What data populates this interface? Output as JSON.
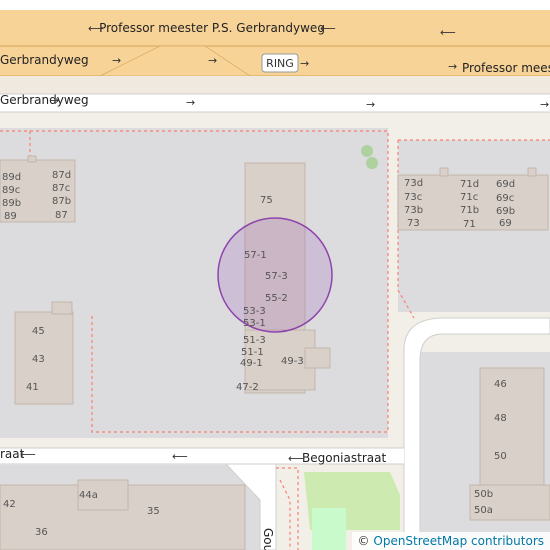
{
  "map": {
    "streets": {
      "top_road": "Professor meester P.S. Gerbrandyweg",
      "mid_left": "Gerbrandyweg",
      "mid_right": "Professor meest",
      "lower_left": "Gerbrandyweg",
      "bottom": "Begoniastraat",
      "bottom_left_fragment": "raat",
      "vertical": "Gou"
    },
    "ring_badge": "RING",
    "house_numbers": {
      "left_top": [
        "89d",
        "89c",
        "89b",
        "89",
        "87d",
        "87c",
        "87b",
        "87"
      ],
      "center": [
        "75",
        "57-1",
        "57-3",
        "55-2",
        "53-3",
        "53-1",
        "51-3",
        "51-1",
        "49-1",
        "49-3",
        "47-2"
      ],
      "right_top": [
        "73d",
        "73c",
        "73b",
        "73",
        "71d",
        "71c",
        "71b",
        "71",
        "69d",
        "69c",
        "69b",
        "69"
      ],
      "left_mid": [
        "45",
        "43",
        "41"
      ],
      "right_mid": [
        "46",
        "48",
        "50",
        "50b",
        "50a"
      ],
      "bottom": [
        "42",
        "44a",
        "35",
        "36"
      ]
    },
    "highlight_color": "#9b59b6"
  },
  "attribution": {
    "symbol": "©",
    "text": "OpenStreetMap contributors"
  }
}
